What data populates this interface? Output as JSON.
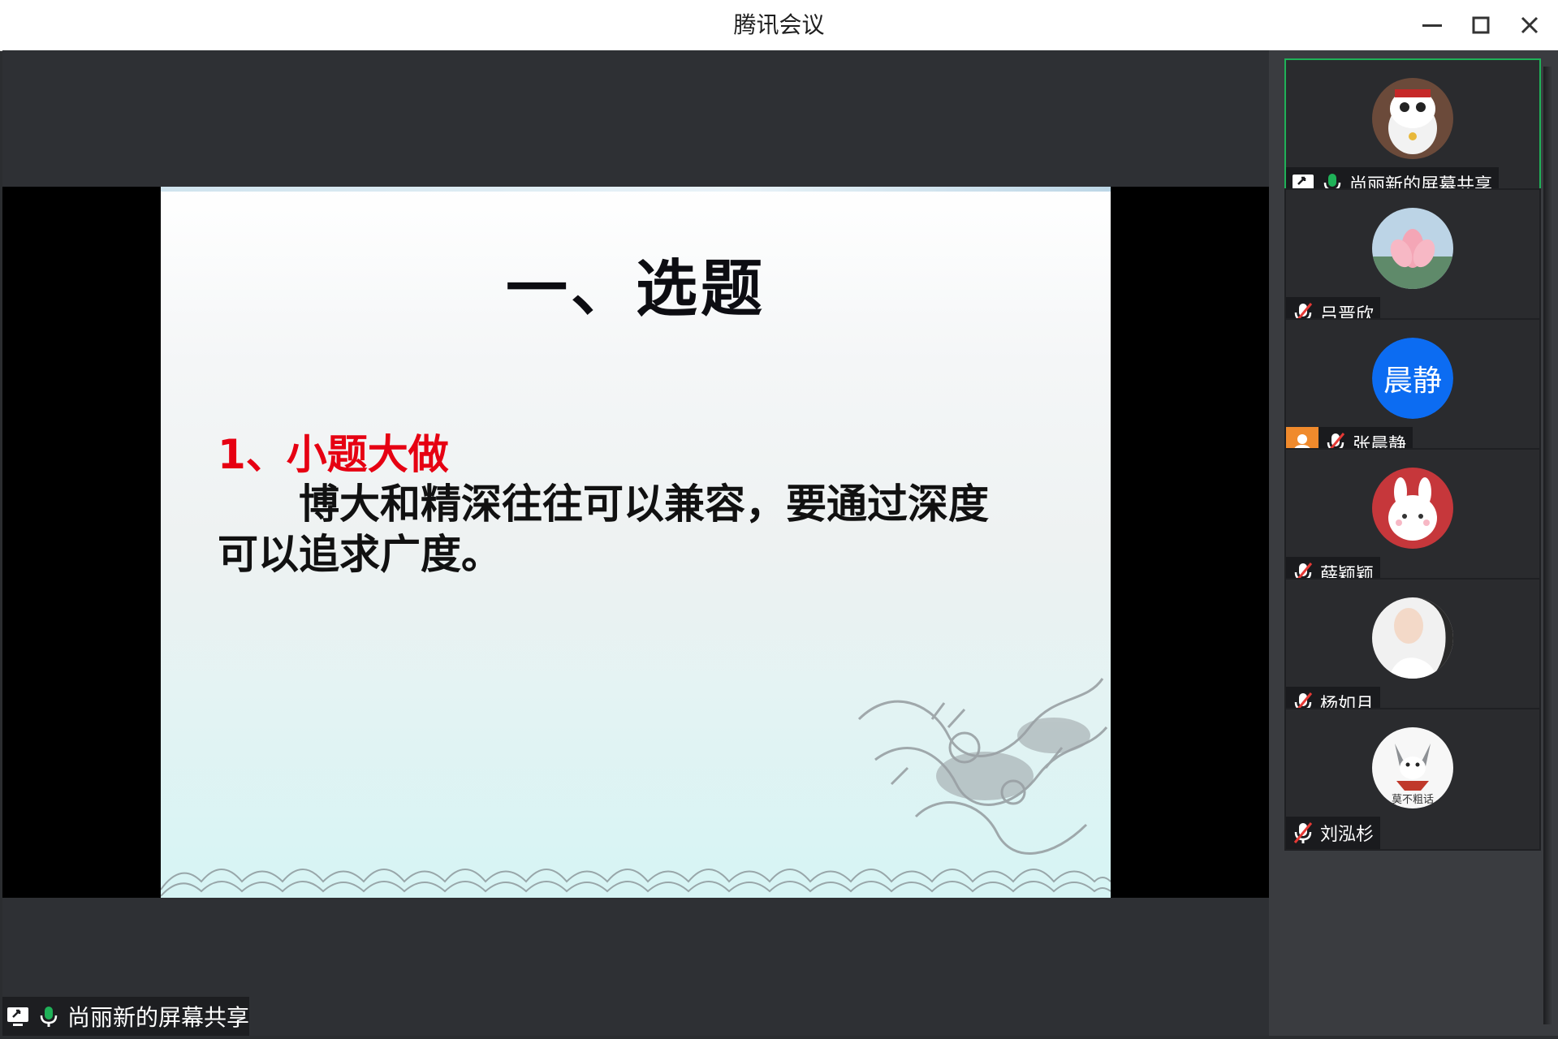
{
  "window": {
    "title": "腾讯会议",
    "minimize_icon": "minimize-icon",
    "maximize_icon": "maximize-icon",
    "close_icon": "close-icon"
  },
  "slide": {
    "title": "一、选题",
    "subtitle": "1、小题大做",
    "body_line1": "博大和精深往往可以兼容，要通过深度",
    "body_line2": "可以追求广度。"
  },
  "share_label": "尚丽新的屏幕共享",
  "participants": [
    {
      "name": "尚丽新的屏幕共享",
      "active": true,
      "icons": [
        "screen-share-icon",
        "mic-on-icon"
      ],
      "avatar": "cat-figurine-avatar"
    },
    {
      "name": "吕晋欣",
      "active": false,
      "icons": [
        "mic-muted-icon"
      ],
      "avatar": "lotus-avatar"
    },
    {
      "name": "张晨静",
      "active": false,
      "icons": [
        "host-icon",
        "mic-muted-icon"
      ],
      "avatar_text": "晨静",
      "avatar_color": "#0c6cf2"
    },
    {
      "name": "薛颖颖",
      "active": false,
      "icons": [
        "mic-muted-icon"
      ],
      "avatar": "bunny-avatar"
    },
    {
      "name": "杨如月",
      "active": false,
      "icons": [
        "mic-muted-icon"
      ],
      "avatar": "girl-photo-avatar"
    },
    {
      "name": "刘泓杉",
      "active": false,
      "icons": [
        "mic-muted-icon"
      ],
      "avatar": "husky-avatar",
      "avatar_caption": "莫不粗话"
    }
  ],
  "colors": {
    "active_border": "#1fb158",
    "mic_on": "#1fb158",
    "host_badge": "#f08a2c",
    "subtitle_red": "#e60012"
  }
}
